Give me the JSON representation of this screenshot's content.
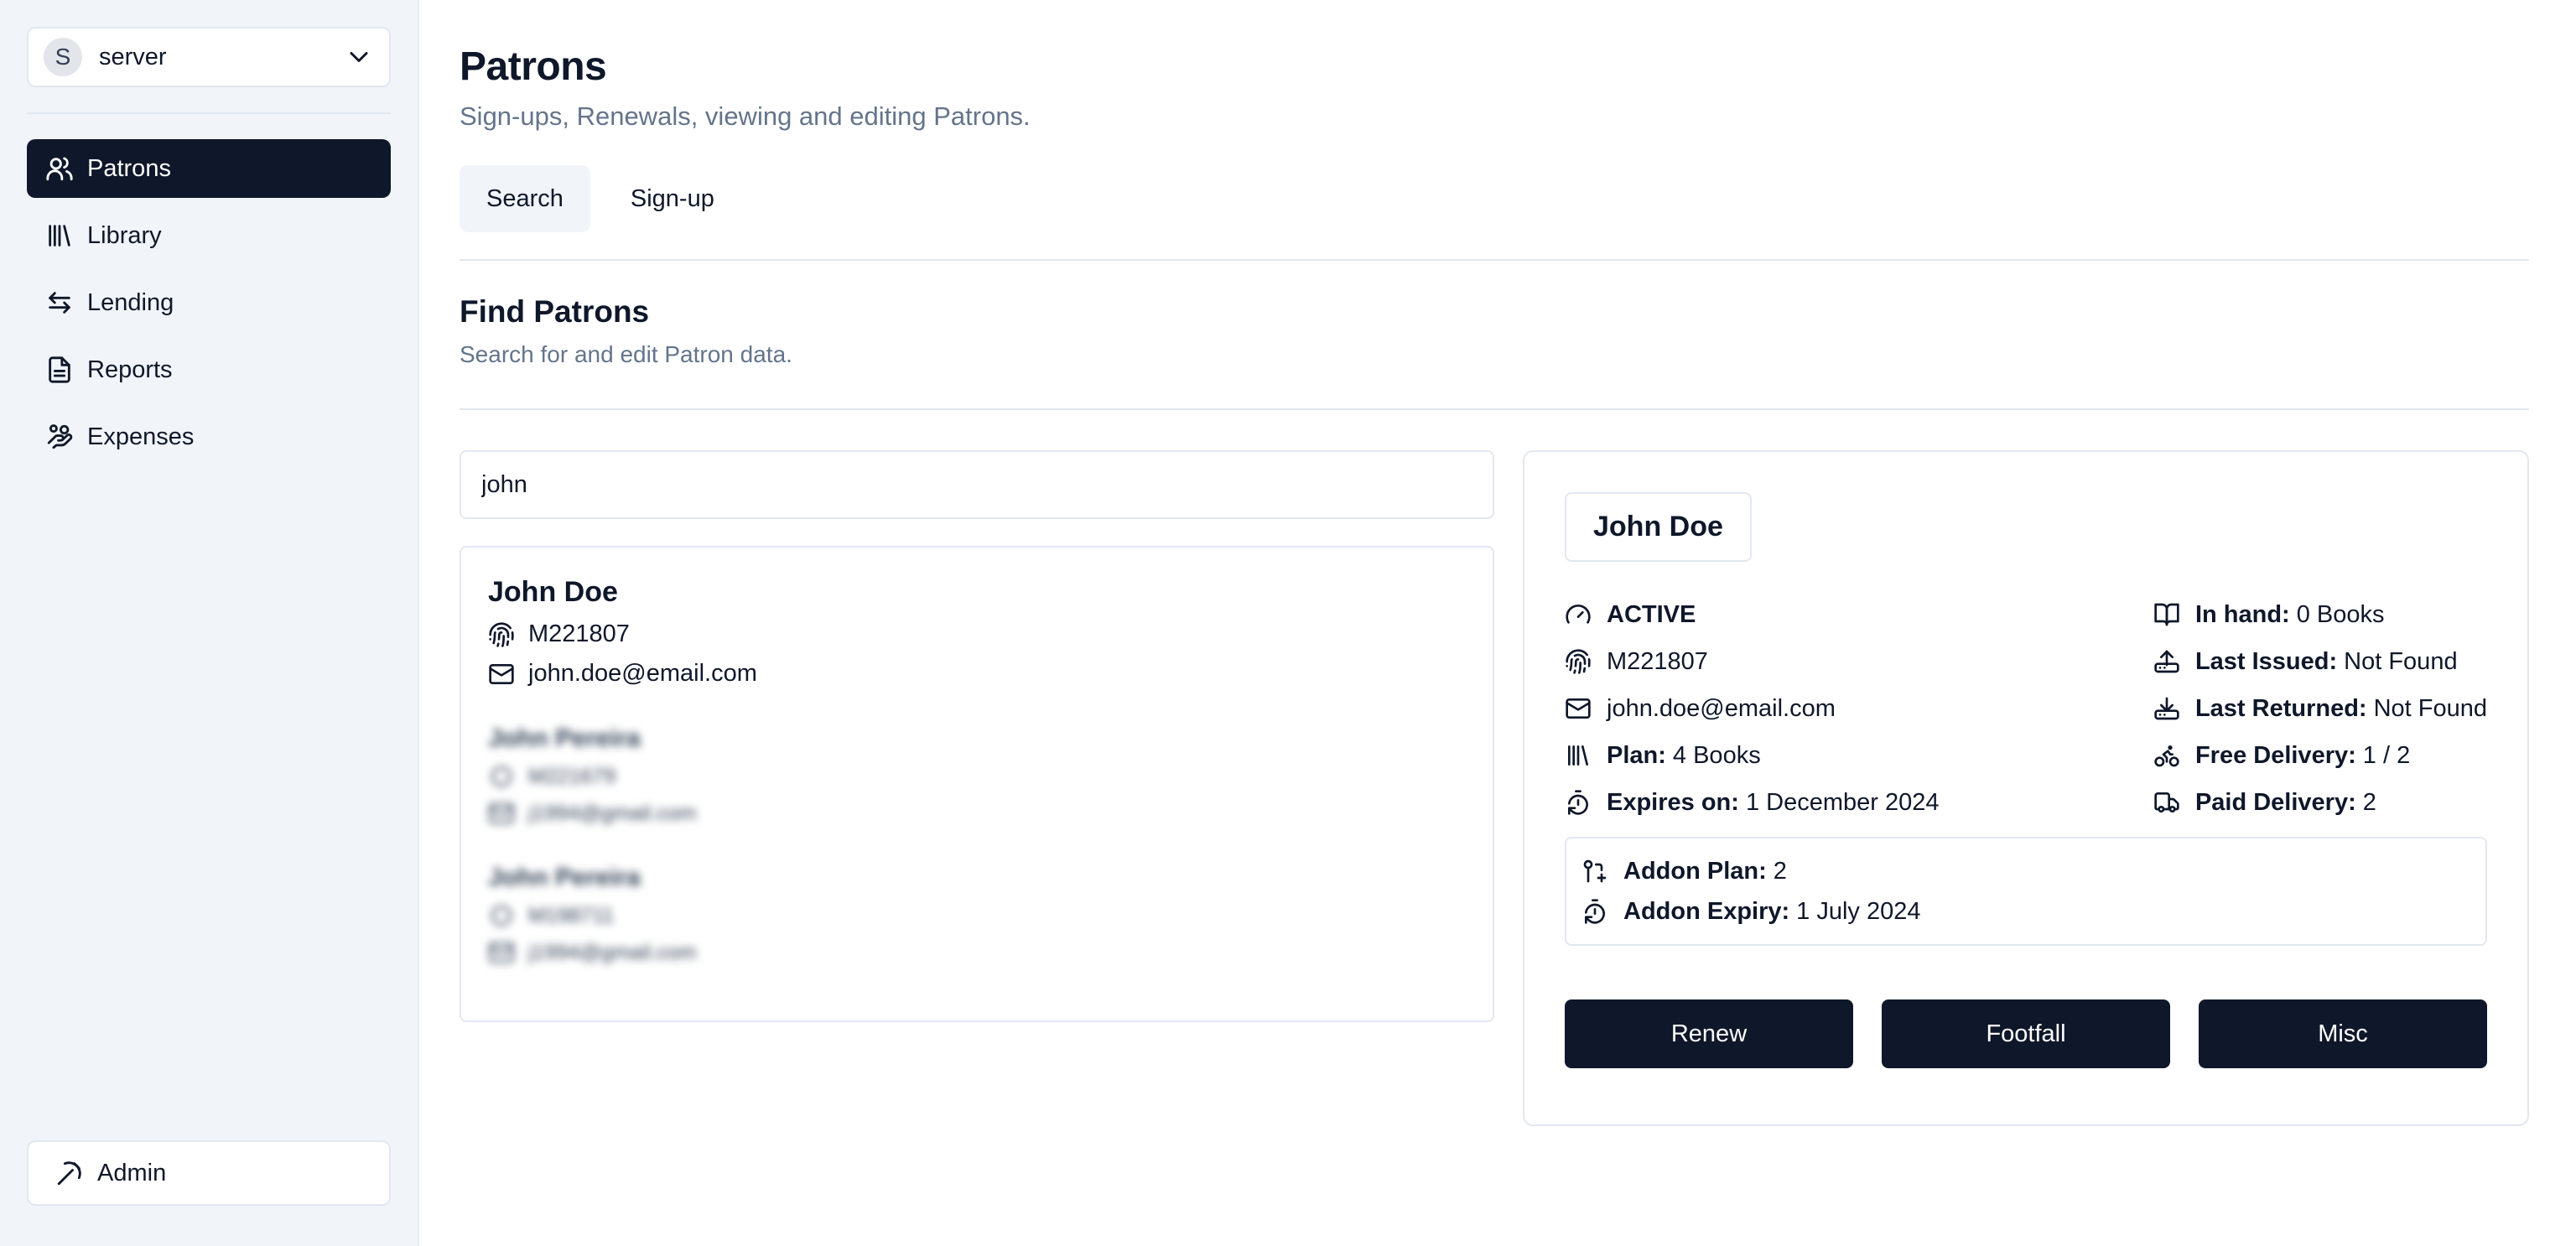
{
  "sidebar": {
    "server": {
      "avatar_letter": "S",
      "name": "server",
      "icon": "chevron-down-icon"
    },
    "items": [
      {
        "label": "Patrons",
        "icon": "users-icon",
        "active": true
      },
      {
        "label": "Library",
        "icon": "library-icon",
        "active": false
      },
      {
        "label": "Lending",
        "icon": "arrows-exchange-icon",
        "active": false
      },
      {
        "label": "Reports",
        "icon": "file-text-icon",
        "active": false
      },
      {
        "label": "Expenses",
        "icon": "hand-coins-icon",
        "active": false
      }
    ],
    "admin": {
      "label": "Admin",
      "icon": "pickaxe-icon"
    }
  },
  "header": {
    "title": "Patrons",
    "subtitle": "Sign-ups, Renewals, viewing and editing Patrons."
  },
  "tabs": [
    {
      "label": "Search",
      "active": true
    },
    {
      "label": "Sign-up",
      "active": false
    }
  ],
  "section": {
    "title": "Find Patrons",
    "subtitle": "Search for and edit Patron data."
  },
  "search": {
    "value": "john"
  },
  "results": [
    {
      "name": "John Doe",
      "id": "M221807",
      "email": "john.doe@email.com",
      "blurred": false
    },
    {
      "name": "John Pereira",
      "id": "M221679",
      "email": "j1994@gmail.com",
      "blurred": true
    },
    {
      "name": "John Pereira",
      "id": "M198711",
      "email": "j1994@gmail.com",
      "blurred": true
    }
  ],
  "detail": {
    "name": "John Doe",
    "status": "ACTIVE",
    "id": "M221807",
    "email": "john.doe@email.com",
    "plan_label": "Plan:",
    "plan_value": "4 Books",
    "expires_label": "Expires on:",
    "expires_value": "1 December 2024",
    "in_hand_label": "In hand:",
    "in_hand_value": "0 Books",
    "last_issued_label": "Last Issued:",
    "last_issued_value": "Not Found",
    "last_returned_label": "Last Returned:",
    "last_returned_value": "Not Found",
    "free_delivery_label": "Free Delivery:",
    "free_delivery_value": "1 / 2",
    "paid_delivery_label": "Paid Delivery:",
    "paid_delivery_value": "2",
    "addon_plan_label": "Addon Plan:",
    "addon_plan_value": "2",
    "addon_expiry_label": "Addon Expiry:",
    "addon_expiry_value": "1 July 2024"
  },
  "actions": {
    "renew": "Renew",
    "footfall": "Footfall",
    "misc": "Misc"
  },
  "colors": {
    "primary": "#0f172a",
    "sidebar_bg": "#f1f4f9",
    "muted_text": "#64748b",
    "border": "#e2e8f0"
  }
}
